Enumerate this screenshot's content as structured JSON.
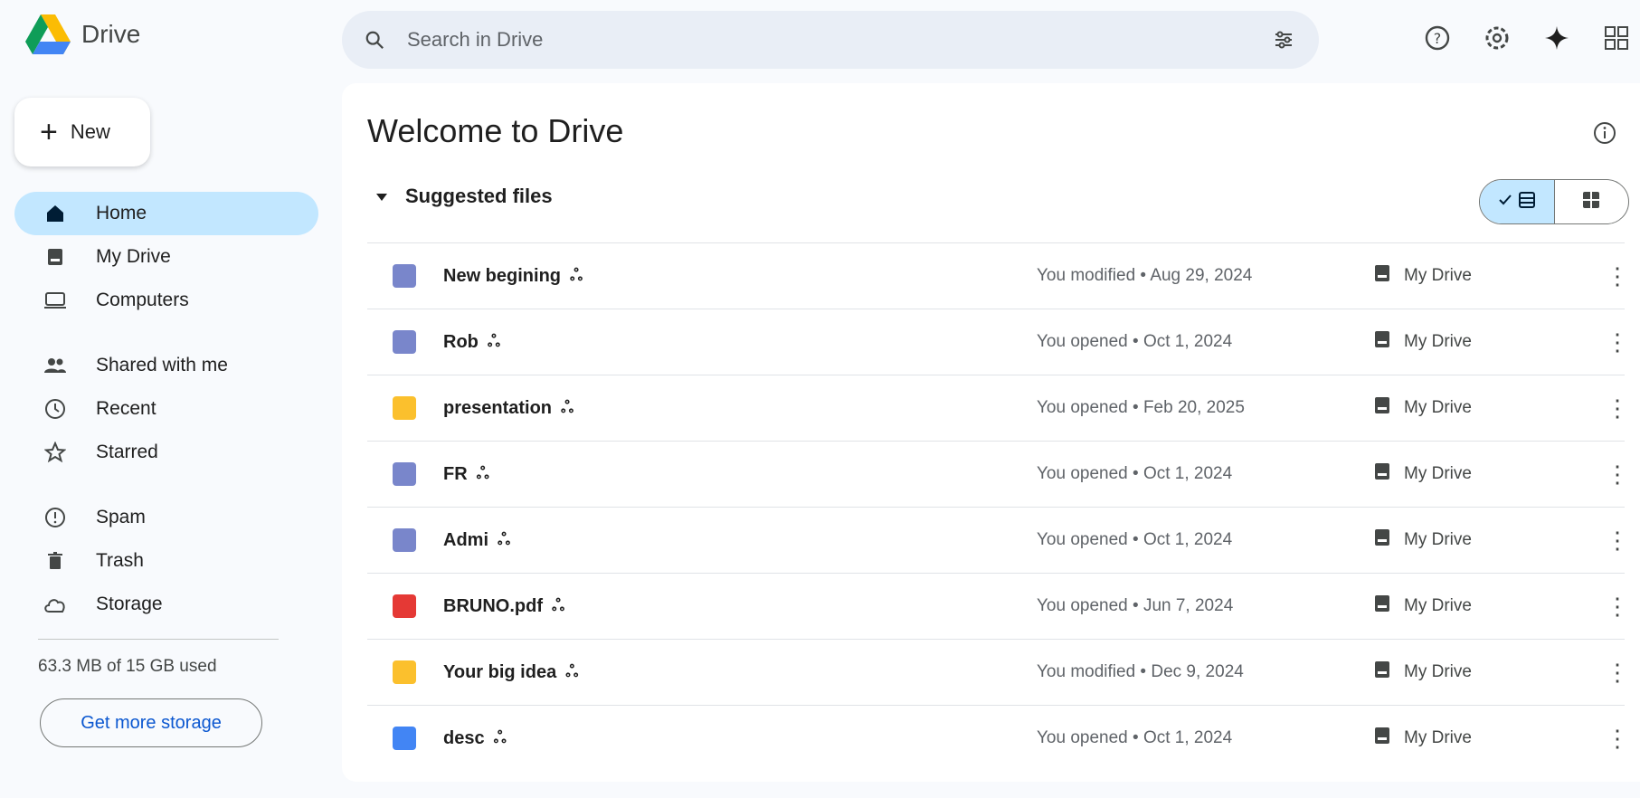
{
  "app": {
    "title": "Drive"
  },
  "search": {
    "placeholder": "Search in Drive"
  },
  "sidebar": {
    "new_label": "New",
    "items": [
      {
        "label": "Home",
        "icon": "home-icon",
        "active": true
      },
      {
        "label": "My Drive",
        "icon": "my-drive-icon"
      },
      {
        "label": "Computers",
        "icon": "computer-icon"
      },
      {
        "label": "Shared with me",
        "icon": "people-icon"
      },
      {
        "label": "Recent",
        "icon": "clock-icon"
      },
      {
        "label": "Starred",
        "icon": "star-icon"
      },
      {
        "label": "Spam",
        "icon": "spam-icon"
      },
      {
        "label": "Trash",
        "icon": "trash-icon"
      },
      {
        "label": "Storage",
        "icon": "cloud-icon"
      }
    ],
    "storage_text": "63.3 MB of 15 GB used",
    "storage_button": "Get more storage"
  },
  "main": {
    "title": "Welcome to Drive",
    "section_title": "Suggested files",
    "files": [
      {
        "name": "New begining",
        "reason": "You modified • Aug 29, 2024",
        "location": "My Drive",
        "type": "doc",
        "color": "#7986cb"
      },
      {
        "name": "Rob",
        "reason": "You opened • Oct 1, 2024",
        "location": "My Drive",
        "type": "doc",
        "color": "#7986cb"
      },
      {
        "name": "presentation",
        "reason": "You opened • Feb 20, 2025",
        "location": "My Drive",
        "type": "slides",
        "color": "#fbc02d"
      },
      {
        "name": "FR",
        "reason": "You opened • Oct 1, 2024",
        "location": "My Drive",
        "type": "doc",
        "color": "#7986cb"
      },
      {
        "name": "Admi",
        "reason": "You opened • Oct 1, 2024",
        "location": "My Drive",
        "type": "doc",
        "color": "#7986cb"
      },
      {
        "name": "BRUNO.pdf",
        "reason": "You opened • Jun 7, 2024",
        "location": "My Drive",
        "type": "pdf",
        "color": "#e53935"
      },
      {
        "name": "Your big idea",
        "reason": "You modified • Dec 9, 2024",
        "location": "My Drive",
        "type": "slides",
        "color": "#fbc02d"
      },
      {
        "name": "desc",
        "reason": "You opened • Oct 1, 2024",
        "location": "My Drive",
        "type": "docs",
        "color": "#4285f4"
      }
    ]
  },
  "colors": {
    "accent": "#0b57d0",
    "active_bg": "#c2e7ff",
    "bg": "#f8fafd"
  }
}
